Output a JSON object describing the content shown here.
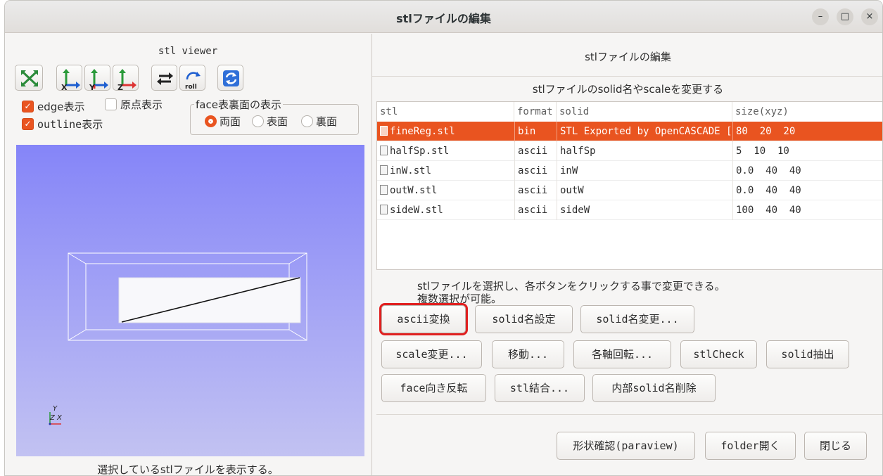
{
  "window": {
    "title": "stlファイルの編集",
    "minimize_glyph": "–",
    "maximize_glyph": "□",
    "close_glyph": "×"
  },
  "viewer": {
    "title": "stl viewer",
    "toolbar": [
      {
        "name": "fit-all-icon"
      },
      {
        "name": "view-x-axis-icon",
        "label": "X"
      },
      {
        "name": "view-y-axis-icon",
        "label": "Y"
      },
      {
        "name": "view-z-axis-icon",
        "label": "Z"
      },
      {
        "name": "reverse-view-icon"
      },
      {
        "name": "roll-icon",
        "label": "roll"
      },
      {
        "name": "reload-icon"
      }
    ],
    "edge_label": "edge表示",
    "edge_checked": true,
    "origin_label": "原点表示",
    "origin_checked": false,
    "outline_label": "outline表示",
    "outline_checked": true,
    "face_group_title": "face表裏面の表示",
    "face_options": [
      "両面",
      "表面",
      "裏面"
    ],
    "face_selected": "両面",
    "axis_y": "Y",
    "axis_z": "Z",
    "axis_x": "X",
    "status": "選択しているstlファイルを表示する。",
    "background_top": "#8585f8",
    "background_bottom": "#c2c2f2"
  },
  "editor": {
    "title": "stlファイルの編集",
    "table_caption": "stlファイルのsolid名やscaleを変更する",
    "columns": [
      "stl",
      "format",
      "solid",
      "size(xyz)"
    ],
    "rows": [
      {
        "stl": "fineReg.stl",
        "format": "bin",
        "solid": "STL Exported by OpenCASCADE [",
        "size": "80  20  20",
        "selected": true
      },
      {
        "stl": "halfSp.stl",
        "format": "ascii",
        "solid": "halfSp",
        "size": "5  10  10",
        "selected": false
      },
      {
        "stl": "inW.stl",
        "format": "ascii",
        "solid": "inW",
        "size": "0.0  40  40",
        "selected": false
      },
      {
        "stl": "outW.stl",
        "format": "ascii",
        "solid": "outW",
        "size": "0.0  40  40",
        "selected": false
      },
      {
        "stl": "sideW.stl",
        "format": "ascii",
        "solid": "sideW",
        "size": "100  40  40",
        "selected": false
      }
    ],
    "hint_line1": "stlファイルを選択し、各ボタンをクリックする事で変更できる。",
    "hint_line2": "複数選択が可能。",
    "buttons": {
      "ascii": "ascii変換",
      "solid_set": "solid名設定",
      "solid_change": "solid名変更...",
      "scale": "scale変更...",
      "move": "移動...",
      "rotate": "各軸回転...",
      "check": "stlCheck",
      "extract": "solid抽出",
      "flip": "face向き反転",
      "merge": "stl結合...",
      "delete_inner": "内部solid名削除",
      "paraview": "形状確認(paraview)",
      "open_folder": "folder開く",
      "close": "閉じる"
    },
    "selection_color": "#e95420",
    "highlight_color": "#e02020"
  }
}
